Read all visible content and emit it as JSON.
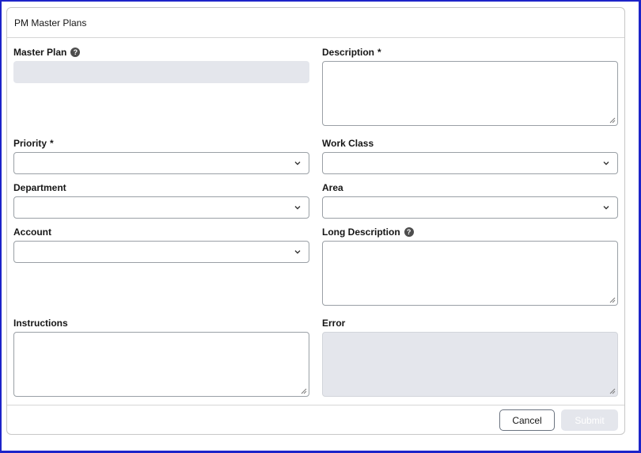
{
  "card": {
    "title": "PM Master Plans"
  },
  "fields": {
    "master_plan": {
      "label": "Master Plan",
      "help": "?"
    },
    "description": {
      "label": "Description",
      "required": "*"
    },
    "priority": {
      "label": "Priority",
      "required": "*"
    },
    "work_class": {
      "label": "Work Class"
    },
    "department": {
      "label": "Department"
    },
    "area": {
      "label": "Area"
    },
    "account": {
      "label": "Account"
    },
    "long_description": {
      "label": "Long Description",
      "help": "?"
    },
    "instructions": {
      "label": "Instructions"
    },
    "error": {
      "label": "Error"
    }
  },
  "buttons": {
    "cancel": "Cancel",
    "submit": "Submit"
  },
  "colors": {
    "frame_border": "#1d24c9",
    "readonly_fill": "#e4e6ec",
    "input_border": "#9aa0a6"
  }
}
